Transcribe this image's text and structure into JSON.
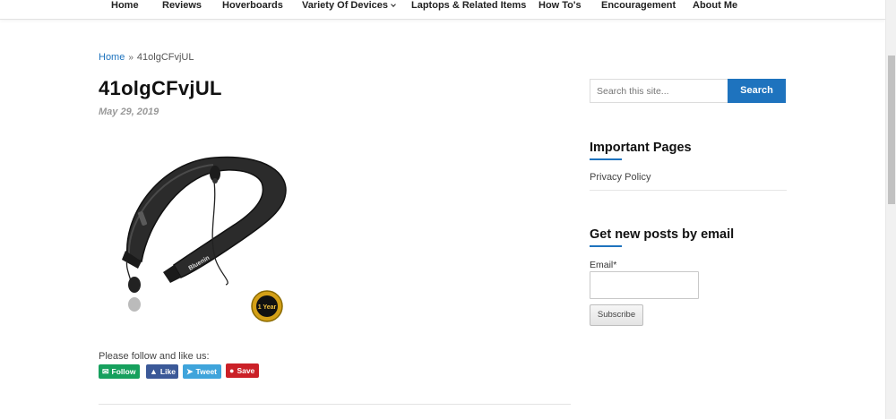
{
  "nav": {
    "items": [
      "Home",
      "Reviews",
      "Hoverboards",
      "Variety Of Devices",
      "Laptops & Related Items",
      "How To's",
      "Encouragement",
      "About Me"
    ]
  },
  "breadcrumb": {
    "home": "Home",
    "current": "41olgCFvjUL"
  },
  "post": {
    "title": "41olgCFvjUL",
    "date": "May 29, 2019"
  },
  "product_image": {
    "brand_text": "Bluenin",
    "badge_text": "1 Year"
  },
  "social": {
    "prompt": "Please follow and like us:",
    "buttons": [
      {
        "label": "Follow",
        "icon": "mail-icon",
        "color": "#16a05d"
      },
      {
        "label": "Like",
        "icon": "thumbs-up-icon",
        "color": "#3b5998"
      },
      {
        "label": "Tweet",
        "icon": "bird-icon",
        "color": "#3fa4db"
      },
      {
        "label": "Save",
        "icon": "pinterest-icon",
        "color": "#cb2027"
      }
    ]
  },
  "sidebar": {
    "search": {
      "placeholder": "Search this site...",
      "button": "Search"
    },
    "important_pages": {
      "title": "Important Pages",
      "links": [
        "Privacy Policy"
      ]
    },
    "newsletter": {
      "title": "Get new posts by email",
      "email_label": "Email*",
      "button": "Subscribe"
    }
  },
  "colors": {
    "accent": "#1e73be"
  }
}
